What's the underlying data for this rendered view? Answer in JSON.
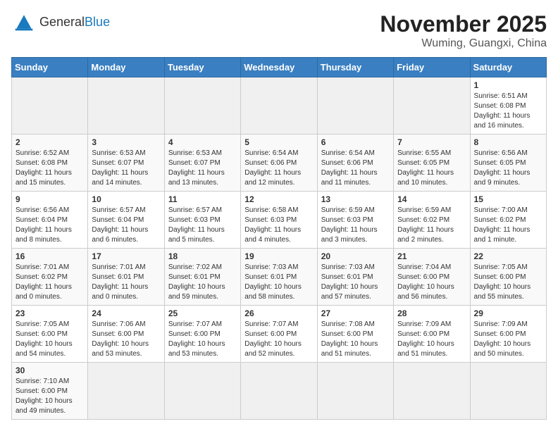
{
  "header": {
    "logo_text_general": "General",
    "logo_text_blue": "Blue",
    "month": "November 2025",
    "location": "Wuming, Guangxi, China"
  },
  "weekdays": [
    "Sunday",
    "Monday",
    "Tuesday",
    "Wednesday",
    "Thursday",
    "Friday",
    "Saturday"
  ],
  "weeks": [
    [
      {
        "day": "",
        "info": ""
      },
      {
        "day": "",
        "info": ""
      },
      {
        "day": "",
        "info": ""
      },
      {
        "day": "",
        "info": ""
      },
      {
        "day": "",
        "info": ""
      },
      {
        "day": "",
        "info": ""
      },
      {
        "day": "1",
        "info": "Sunrise: 6:51 AM\nSunset: 6:08 PM\nDaylight: 11 hours and 16 minutes."
      }
    ],
    [
      {
        "day": "2",
        "info": "Sunrise: 6:52 AM\nSunset: 6:08 PM\nDaylight: 11 hours and 15 minutes."
      },
      {
        "day": "3",
        "info": "Sunrise: 6:53 AM\nSunset: 6:07 PM\nDaylight: 11 hours and 14 minutes."
      },
      {
        "day": "4",
        "info": "Sunrise: 6:53 AM\nSunset: 6:07 PM\nDaylight: 11 hours and 13 minutes."
      },
      {
        "day": "5",
        "info": "Sunrise: 6:54 AM\nSunset: 6:06 PM\nDaylight: 11 hours and 12 minutes."
      },
      {
        "day": "6",
        "info": "Sunrise: 6:54 AM\nSunset: 6:06 PM\nDaylight: 11 hours and 11 minutes."
      },
      {
        "day": "7",
        "info": "Sunrise: 6:55 AM\nSunset: 6:05 PM\nDaylight: 11 hours and 10 minutes."
      },
      {
        "day": "8",
        "info": "Sunrise: 6:56 AM\nSunset: 6:05 PM\nDaylight: 11 hours and 9 minutes."
      }
    ],
    [
      {
        "day": "9",
        "info": "Sunrise: 6:56 AM\nSunset: 6:04 PM\nDaylight: 11 hours and 8 minutes."
      },
      {
        "day": "10",
        "info": "Sunrise: 6:57 AM\nSunset: 6:04 PM\nDaylight: 11 hours and 6 minutes."
      },
      {
        "day": "11",
        "info": "Sunrise: 6:57 AM\nSunset: 6:03 PM\nDaylight: 11 hours and 5 minutes."
      },
      {
        "day": "12",
        "info": "Sunrise: 6:58 AM\nSunset: 6:03 PM\nDaylight: 11 hours and 4 minutes."
      },
      {
        "day": "13",
        "info": "Sunrise: 6:59 AM\nSunset: 6:03 PM\nDaylight: 11 hours and 3 minutes."
      },
      {
        "day": "14",
        "info": "Sunrise: 6:59 AM\nSunset: 6:02 PM\nDaylight: 11 hours and 2 minutes."
      },
      {
        "day": "15",
        "info": "Sunrise: 7:00 AM\nSunset: 6:02 PM\nDaylight: 11 hours and 1 minute."
      }
    ],
    [
      {
        "day": "16",
        "info": "Sunrise: 7:01 AM\nSunset: 6:02 PM\nDaylight: 11 hours and 0 minutes."
      },
      {
        "day": "17",
        "info": "Sunrise: 7:01 AM\nSunset: 6:01 PM\nDaylight: 11 hours and 0 minutes."
      },
      {
        "day": "18",
        "info": "Sunrise: 7:02 AM\nSunset: 6:01 PM\nDaylight: 10 hours and 59 minutes."
      },
      {
        "day": "19",
        "info": "Sunrise: 7:03 AM\nSunset: 6:01 PM\nDaylight: 10 hours and 58 minutes."
      },
      {
        "day": "20",
        "info": "Sunrise: 7:03 AM\nSunset: 6:01 PM\nDaylight: 10 hours and 57 minutes."
      },
      {
        "day": "21",
        "info": "Sunrise: 7:04 AM\nSunset: 6:00 PM\nDaylight: 10 hours and 56 minutes."
      },
      {
        "day": "22",
        "info": "Sunrise: 7:05 AM\nSunset: 6:00 PM\nDaylight: 10 hours and 55 minutes."
      }
    ],
    [
      {
        "day": "23",
        "info": "Sunrise: 7:05 AM\nSunset: 6:00 PM\nDaylight: 10 hours and 54 minutes."
      },
      {
        "day": "24",
        "info": "Sunrise: 7:06 AM\nSunset: 6:00 PM\nDaylight: 10 hours and 53 minutes."
      },
      {
        "day": "25",
        "info": "Sunrise: 7:07 AM\nSunset: 6:00 PM\nDaylight: 10 hours and 53 minutes."
      },
      {
        "day": "26",
        "info": "Sunrise: 7:07 AM\nSunset: 6:00 PM\nDaylight: 10 hours and 52 minutes."
      },
      {
        "day": "27",
        "info": "Sunrise: 7:08 AM\nSunset: 6:00 PM\nDaylight: 10 hours and 51 minutes."
      },
      {
        "day": "28",
        "info": "Sunrise: 7:09 AM\nSunset: 6:00 PM\nDaylight: 10 hours and 51 minutes."
      },
      {
        "day": "29",
        "info": "Sunrise: 7:09 AM\nSunset: 6:00 PM\nDaylight: 10 hours and 50 minutes."
      }
    ],
    [
      {
        "day": "30",
        "info": "Sunrise: 7:10 AM\nSunset: 6:00 PM\nDaylight: 10 hours and 49 minutes."
      },
      {
        "day": "",
        "info": ""
      },
      {
        "day": "",
        "info": ""
      },
      {
        "day": "",
        "info": ""
      },
      {
        "day": "",
        "info": ""
      },
      {
        "day": "",
        "info": ""
      },
      {
        "day": "",
        "info": ""
      }
    ]
  ]
}
